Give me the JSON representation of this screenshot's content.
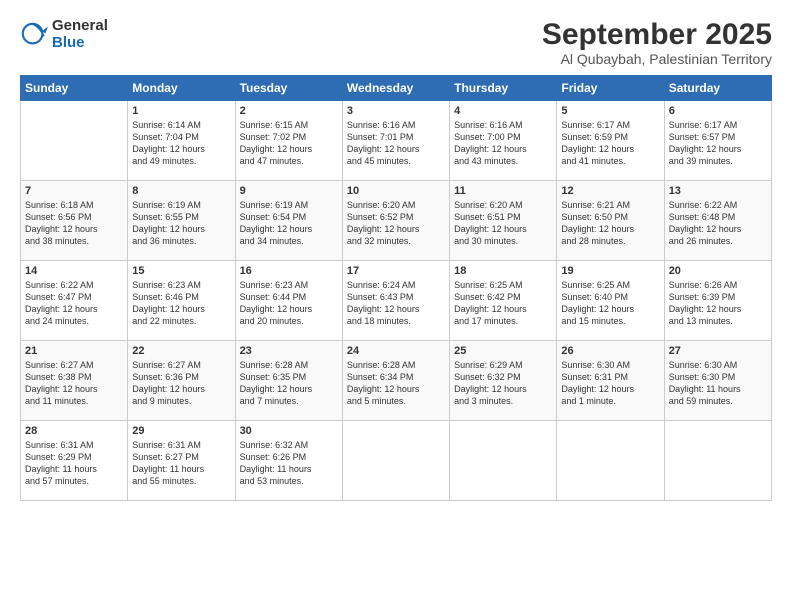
{
  "logo": {
    "general": "General",
    "blue": "Blue"
  },
  "title": "September 2025",
  "subtitle": "Al Qubaybah, Palestinian Territory",
  "days_header": [
    "Sunday",
    "Monday",
    "Tuesday",
    "Wednesday",
    "Thursday",
    "Friday",
    "Saturday"
  ],
  "weeks": [
    [
      {
        "day": "",
        "lines": []
      },
      {
        "day": "1",
        "lines": [
          "Sunrise: 6:14 AM",
          "Sunset: 7:04 PM",
          "Daylight: 12 hours",
          "and 49 minutes."
        ]
      },
      {
        "day": "2",
        "lines": [
          "Sunrise: 6:15 AM",
          "Sunset: 7:02 PM",
          "Daylight: 12 hours",
          "and 47 minutes."
        ]
      },
      {
        "day": "3",
        "lines": [
          "Sunrise: 6:16 AM",
          "Sunset: 7:01 PM",
          "Daylight: 12 hours",
          "and 45 minutes."
        ]
      },
      {
        "day": "4",
        "lines": [
          "Sunrise: 6:16 AM",
          "Sunset: 7:00 PM",
          "Daylight: 12 hours",
          "and 43 minutes."
        ]
      },
      {
        "day": "5",
        "lines": [
          "Sunrise: 6:17 AM",
          "Sunset: 6:59 PM",
          "Daylight: 12 hours",
          "and 41 minutes."
        ]
      },
      {
        "day": "6",
        "lines": [
          "Sunrise: 6:17 AM",
          "Sunset: 6:57 PM",
          "Daylight: 12 hours",
          "and 39 minutes."
        ]
      }
    ],
    [
      {
        "day": "7",
        "lines": [
          "Sunrise: 6:18 AM",
          "Sunset: 6:56 PM",
          "Daylight: 12 hours",
          "and 38 minutes."
        ]
      },
      {
        "day": "8",
        "lines": [
          "Sunrise: 6:19 AM",
          "Sunset: 6:55 PM",
          "Daylight: 12 hours",
          "and 36 minutes."
        ]
      },
      {
        "day": "9",
        "lines": [
          "Sunrise: 6:19 AM",
          "Sunset: 6:54 PM",
          "Daylight: 12 hours",
          "and 34 minutes."
        ]
      },
      {
        "day": "10",
        "lines": [
          "Sunrise: 6:20 AM",
          "Sunset: 6:52 PM",
          "Daylight: 12 hours",
          "and 32 minutes."
        ]
      },
      {
        "day": "11",
        "lines": [
          "Sunrise: 6:20 AM",
          "Sunset: 6:51 PM",
          "Daylight: 12 hours",
          "and 30 minutes."
        ]
      },
      {
        "day": "12",
        "lines": [
          "Sunrise: 6:21 AM",
          "Sunset: 6:50 PM",
          "Daylight: 12 hours",
          "and 28 minutes."
        ]
      },
      {
        "day": "13",
        "lines": [
          "Sunrise: 6:22 AM",
          "Sunset: 6:48 PM",
          "Daylight: 12 hours",
          "and 26 minutes."
        ]
      }
    ],
    [
      {
        "day": "14",
        "lines": [
          "Sunrise: 6:22 AM",
          "Sunset: 6:47 PM",
          "Daylight: 12 hours",
          "and 24 minutes."
        ]
      },
      {
        "day": "15",
        "lines": [
          "Sunrise: 6:23 AM",
          "Sunset: 6:46 PM",
          "Daylight: 12 hours",
          "and 22 minutes."
        ]
      },
      {
        "day": "16",
        "lines": [
          "Sunrise: 6:23 AM",
          "Sunset: 6:44 PM",
          "Daylight: 12 hours",
          "and 20 minutes."
        ]
      },
      {
        "day": "17",
        "lines": [
          "Sunrise: 6:24 AM",
          "Sunset: 6:43 PM",
          "Daylight: 12 hours",
          "and 18 minutes."
        ]
      },
      {
        "day": "18",
        "lines": [
          "Sunrise: 6:25 AM",
          "Sunset: 6:42 PM",
          "Daylight: 12 hours",
          "and 17 minutes."
        ]
      },
      {
        "day": "19",
        "lines": [
          "Sunrise: 6:25 AM",
          "Sunset: 6:40 PM",
          "Daylight: 12 hours",
          "and 15 minutes."
        ]
      },
      {
        "day": "20",
        "lines": [
          "Sunrise: 6:26 AM",
          "Sunset: 6:39 PM",
          "Daylight: 12 hours",
          "and 13 minutes."
        ]
      }
    ],
    [
      {
        "day": "21",
        "lines": [
          "Sunrise: 6:27 AM",
          "Sunset: 6:38 PM",
          "Daylight: 12 hours",
          "and 11 minutes."
        ]
      },
      {
        "day": "22",
        "lines": [
          "Sunrise: 6:27 AM",
          "Sunset: 6:36 PM",
          "Daylight: 12 hours",
          "and 9 minutes."
        ]
      },
      {
        "day": "23",
        "lines": [
          "Sunrise: 6:28 AM",
          "Sunset: 6:35 PM",
          "Daylight: 12 hours",
          "and 7 minutes."
        ]
      },
      {
        "day": "24",
        "lines": [
          "Sunrise: 6:28 AM",
          "Sunset: 6:34 PM",
          "Daylight: 12 hours",
          "and 5 minutes."
        ]
      },
      {
        "day": "25",
        "lines": [
          "Sunrise: 6:29 AM",
          "Sunset: 6:32 PM",
          "Daylight: 12 hours",
          "and 3 minutes."
        ]
      },
      {
        "day": "26",
        "lines": [
          "Sunrise: 6:30 AM",
          "Sunset: 6:31 PM",
          "Daylight: 12 hours",
          "and 1 minute."
        ]
      },
      {
        "day": "27",
        "lines": [
          "Sunrise: 6:30 AM",
          "Sunset: 6:30 PM",
          "Daylight: 11 hours",
          "and 59 minutes."
        ]
      }
    ],
    [
      {
        "day": "28",
        "lines": [
          "Sunrise: 6:31 AM",
          "Sunset: 6:29 PM",
          "Daylight: 11 hours",
          "and 57 minutes."
        ]
      },
      {
        "day": "29",
        "lines": [
          "Sunrise: 6:31 AM",
          "Sunset: 6:27 PM",
          "Daylight: 11 hours",
          "and 55 minutes."
        ]
      },
      {
        "day": "30",
        "lines": [
          "Sunrise: 6:32 AM",
          "Sunset: 6:26 PM",
          "Daylight: 11 hours",
          "and 53 minutes."
        ]
      },
      {
        "day": "",
        "lines": []
      },
      {
        "day": "",
        "lines": []
      },
      {
        "day": "",
        "lines": []
      },
      {
        "day": "",
        "lines": []
      }
    ]
  ]
}
